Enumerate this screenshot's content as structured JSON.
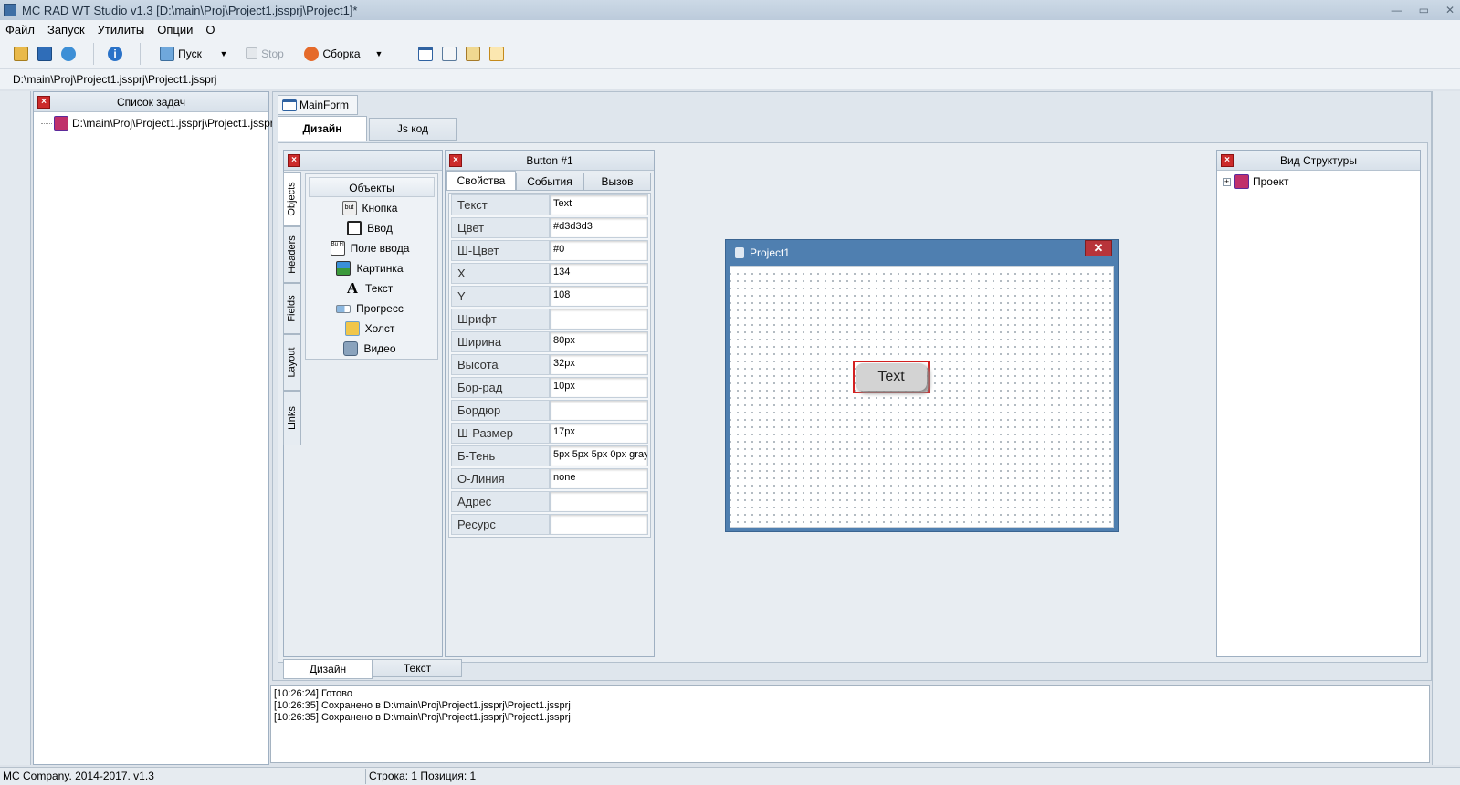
{
  "window": {
    "title": "MC RAD WT Studio v1.3 [D:\\main\\Proj\\Project1.jssprj\\Project1]*",
    "minimize": "—",
    "maximize": "▭",
    "close": "✕"
  },
  "menu": [
    "Файл",
    "Запуск",
    "Утилиты",
    "Опции",
    "О"
  ],
  "toolbar": {
    "run_label": "Пуск",
    "stop_label": "Stop",
    "build_label": "Сборка"
  },
  "path": "D:\\main\\Proj\\Project1.jssprj\\Project1.jssprj",
  "task_panel": {
    "title": "Список задач",
    "item": "D:\\main\\Proj\\Project1.jssprj\\Project1.jssprj"
  },
  "form_tab": "MainForm",
  "design_tabs": {
    "design": "Дизайн",
    "js": "Js код"
  },
  "objects": {
    "header": "Объекты",
    "vtabs": [
      "Objects",
      "Headers",
      "Fields",
      "Layout",
      "Links"
    ],
    "items": [
      "Кнопка",
      "Ввод",
      "Поле ввода",
      "Картинка",
      "Текст",
      "Прогресс",
      "Холст",
      "Видео"
    ],
    "icon_text": {
      "button": "but",
      "field": "Bu Fl"
    }
  },
  "props": {
    "title": "Button #1",
    "tabs": [
      "Свойства",
      "События",
      "Вызов"
    ],
    "rows": [
      {
        "name": "Текст",
        "value": "Text"
      },
      {
        "name": "Цвет",
        "value": "#d3d3d3"
      },
      {
        "name": "Ш-Цвет",
        "value": "#0"
      },
      {
        "name": "X",
        "value": "134"
      },
      {
        "name": "Y",
        "value": "108"
      },
      {
        "name": "Шрифт",
        "value": ""
      },
      {
        "name": "Ширина",
        "value": "80px"
      },
      {
        "name": "Высота",
        "value": "32px"
      },
      {
        "name": "Бор-рад",
        "value": "10px"
      },
      {
        "name": "Бордюр",
        "value": ""
      },
      {
        "name": "Ш-Размер",
        "value": "17px"
      },
      {
        "name": "Б-Тень",
        "value": "5px 5px 5px 0px gray"
      },
      {
        "name": "О-Линия",
        "value": "none"
      },
      {
        "name": "Адрес",
        "value": ""
      },
      {
        "name": "Ресурс",
        "value": ""
      }
    ]
  },
  "preview": {
    "title": "Project1",
    "button_text": "Text",
    "close": "✕"
  },
  "structure": {
    "title": "Вид Структуры",
    "root": "Проект",
    "expander": "+"
  },
  "bottom_tabs": {
    "design": "Дизайн",
    "text": "Текст"
  },
  "log": [
    "[10:26:24] Готово",
    "[10:26:35] Сохранено в D:\\main\\Proj\\Project1.jssprj\\Project1.jssprj",
    "[10:26:35] Сохранено в D:\\main\\Proj\\Project1.jssprj\\Project1.jssprj"
  ],
  "status": {
    "left": "MC Company. 2014-2017. v1.3",
    "right": "Строка: 1 Позиция: 1"
  },
  "colors": {
    "accent": "#4f7fb0",
    "selection": "#d42020",
    "close_red": "#b8343a"
  }
}
